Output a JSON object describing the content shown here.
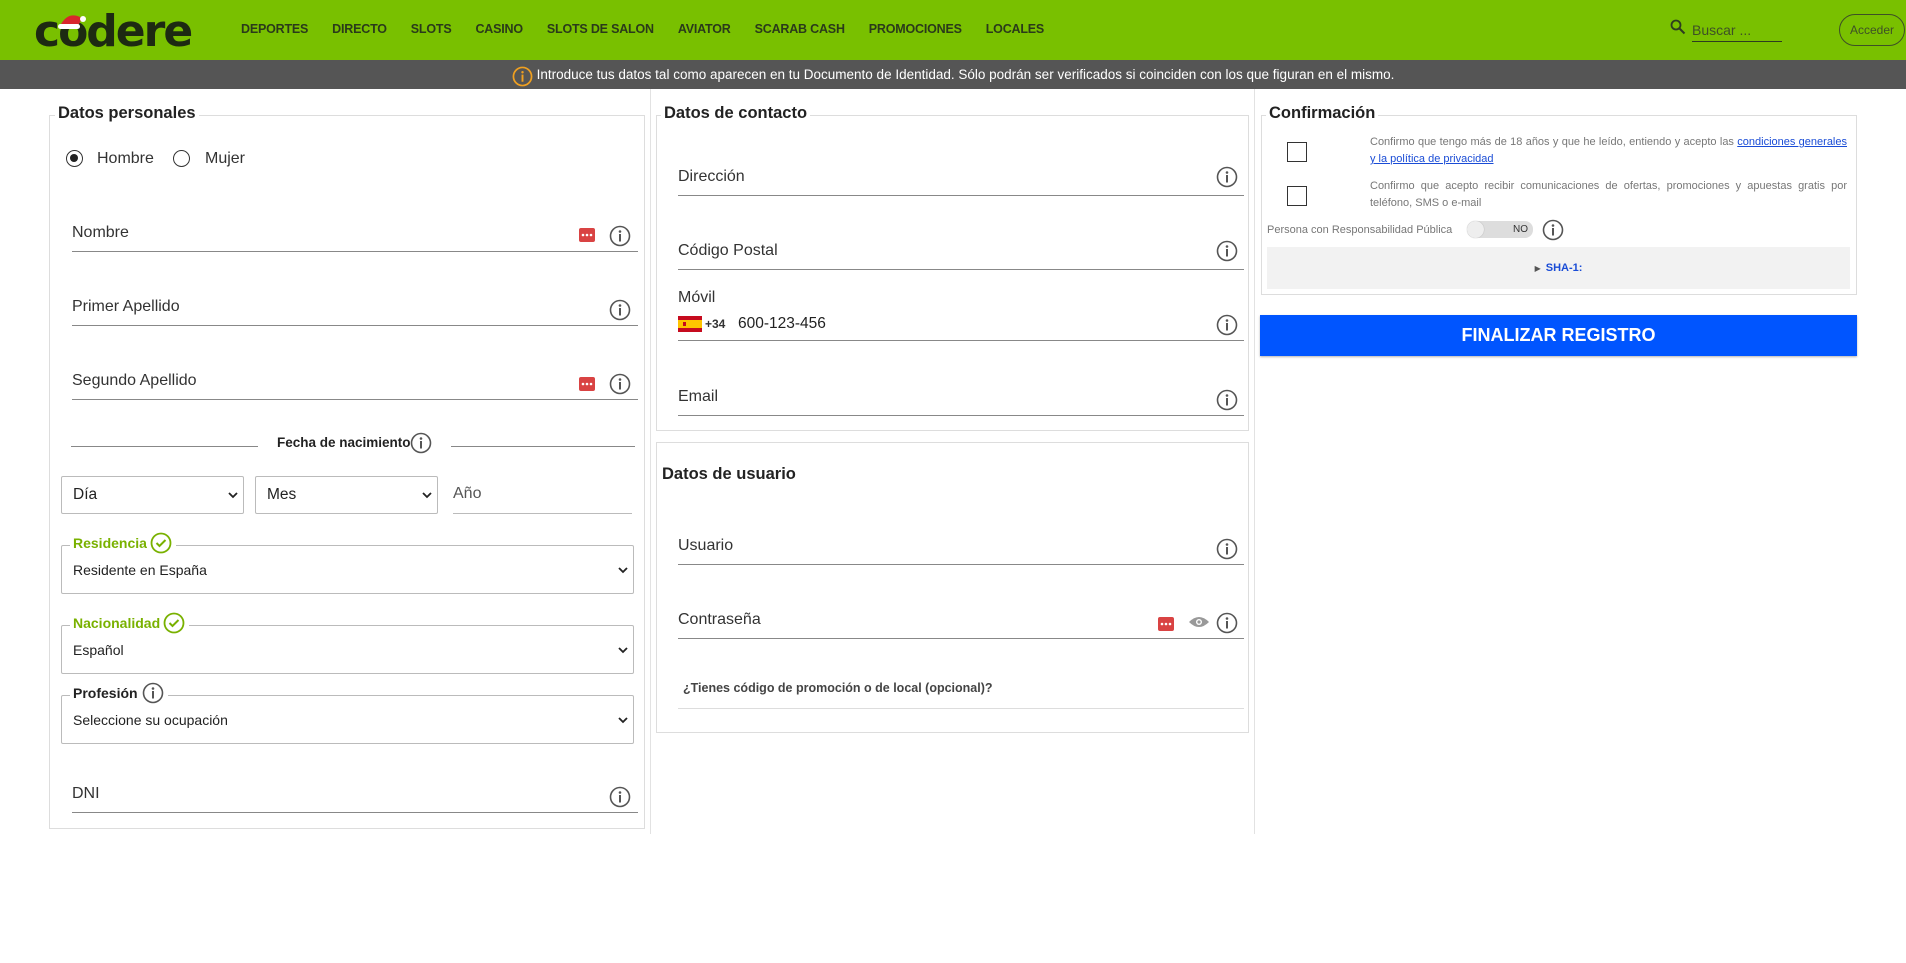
{
  "header": {
    "logo_text": "codere",
    "nav": [
      "DEPORTES",
      "DIRECTO",
      "SLOTS",
      "CASINO",
      "SLOTS DE SALON",
      "AVIATOR",
      "SCARAB CASH",
      "PROMOCIONES",
      "LOCALES"
    ],
    "search_placeholder": "Buscar ...",
    "login_label": "Acceder"
  },
  "notice": {
    "text": "Introduce tus datos tal como aparecen en tu Documento de Identidad. Sólo podrán ser verificados si coinciden con los que figuran en el mismo."
  },
  "personal": {
    "title": "Datos personales",
    "gender_male": "Hombre",
    "gender_female": "Mujer",
    "gender_selected": "Hombre",
    "nombre": "Nombre",
    "primer_apellido": "Primer Apellido",
    "segundo_apellido": "Segundo Apellido",
    "fecha_label": "Fecha de nacimiento",
    "dia": "Día",
    "mes": "Mes",
    "anio_placeholder": "Año",
    "residencia_label": "Residencia",
    "residencia_value": "Residente en España",
    "nacionalidad_label": "Nacionalidad",
    "nacionalidad_value": "Español",
    "profesion_label": "Profesión",
    "profesion_value": "Seleccione su ocupación",
    "dni": "DNI"
  },
  "contact": {
    "title": "Datos de contacto",
    "direccion": "Dirección",
    "codigo_postal": "Código Postal",
    "movil_label": "Móvil",
    "prefix": "+34",
    "movil_value": "600-123-456",
    "email": "Email"
  },
  "user": {
    "title": "Datos de usuario",
    "usuario": "Usuario",
    "contrasena": "Contraseña",
    "promo": "¿Tienes código de promoción o de local (opcional)?"
  },
  "confirm": {
    "title": "Confirmación",
    "consent1_text": "Confirmo que tengo más de 18 años y que he leído, entiendo y acepto las ",
    "consent1_link": "condiciones generales y la política de privacidad",
    "consent2_text": "Confirmo que acepto recibir comunicaciones de ofertas, promociones y apuestas gratis por teléfono, SMS o e-mail",
    "prp_label": "Persona con Responsabilidad Pública",
    "prp_toggle": "NO",
    "sha_label": "SHA-1:",
    "finalize": "FINALIZAR REGISTRO"
  },
  "colors": {
    "header_bg": "#79c000",
    "notice_bg": "#555555",
    "finalize_bg": "#0055ff",
    "valid_green": "#79b100"
  }
}
